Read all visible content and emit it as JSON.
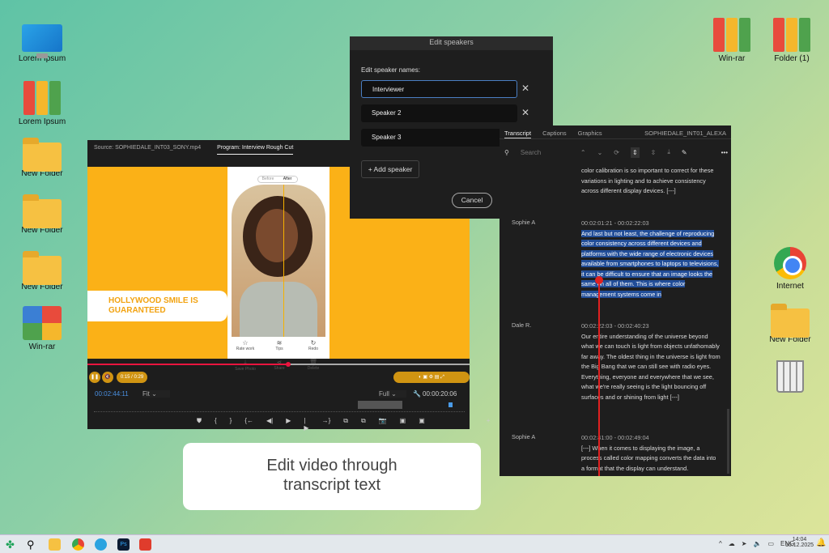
{
  "desktop": {
    "icons": [
      {
        "label": "Lorem Ipsum",
        "type": "monitor"
      },
      {
        "label": "Lorem Ipsum",
        "type": "binder"
      },
      {
        "label": "New Folder",
        "type": "folder"
      },
      {
        "label": "New Folder",
        "type": "folder"
      },
      {
        "label": "New Folder",
        "type": "folder"
      },
      {
        "label": "Win-rar",
        "type": "rar"
      },
      {
        "label": "Win-rar",
        "type": "binder"
      },
      {
        "label": "Folder (1)",
        "type": "binder"
      },
      {
        "label": "Internet",
        "type": "chrome"
      },
      {
        "label": "New Folder",
        "type": "folder"
      },
      {
        "label": "",
        "type": "trash"
      }
    ]
  },
  "premiere": {
    "source_tab": "Source: SOPHIEDALE_INT03_SONY.mp4",
    "program_tab": "Program: Interview Rough Cut",
    "before": "Before",
    "after": "After",
    "headline": "HOLLYWOOD SMILE IS GUARANTEED",
    "phone_tools": [
      "Rate work",
      "Tips",
      "Redo",
      "Save Photo",
      "Share",
      "Delete"
    ],
    "player_time": "0:15 / 0:29",
    "playback_progress": 0.52,
    "timecode": "00:02:44:11",
    "fit": "Fit",
    "quality": "Full",
    "duration": "00:00:20:06"
  },
  "dialog": {
    "title": "Edit speakers",
    "label": "Edit speaker names:",
    "speakers": [
      "Interviewer",
      "Speaker 2",
      "Speaker 3"
    ],
    "add": "+ Add speaker",
    "cancel": "Cancel"
  },
  "transcript": {
    "tabs": [
      "Transcript",
      "Captions",
      "Graphics"
    ],
    "clip": "SOPHIEDALE_INT01_ALEXA",
    "search_placeholder": "Search",
    "segments": [
      {
        "speaker": "",
        "time": "",
        "text": "color calibration is so important to correct for these variations in lighting and to achieve consistency across different display devices. [---]"
      },
      {
        "speaker": "Sophie A",
        "time": "00:02:01:21 - 00:02:22:03",
        "text": "And last but not least, the challenge of reproducing color consistency across different devices and platforms with the wide range of electronic devices available from smartphones to laptops to televisions, it can be difficult to ensure that an image looks the same on all of them. This is where color management systems come in",
        "highlighted": true
      },
      {
        "speaker": "Dale R.",
        "time": "00:02:22:03 - 00:02:40:23",
        "text": "Our entire understanding of the universe beyond what we can touch is light from objects unfathomably far away. The oldest thing in the universe is light from the Big Bang that we can still see with radio eyes. Everything, everyone and everywhere that we see, what we're really seeing is the light bouncing off surfaces and or shining from light [---]"
      },
      {
        "speaker": "Sophie A",
        "time": "00:02:41:00 - 00:02:49:04",
        "text": "[---] When it comes to displaying the image, a process called color mapping converts the data into a format that the display can understand."
      }
    ]
  },
  "caption": "Edit video through transcript text",
  "taskbar": {
    "lang": "ENG",
    "time": "14:04",
    "date": "10.12.2025"
  },
  "colors": {
    "accent": "#fbb117",
    "highlight": "#214d98",
    "playhead": "#e9153f"
  }
}
